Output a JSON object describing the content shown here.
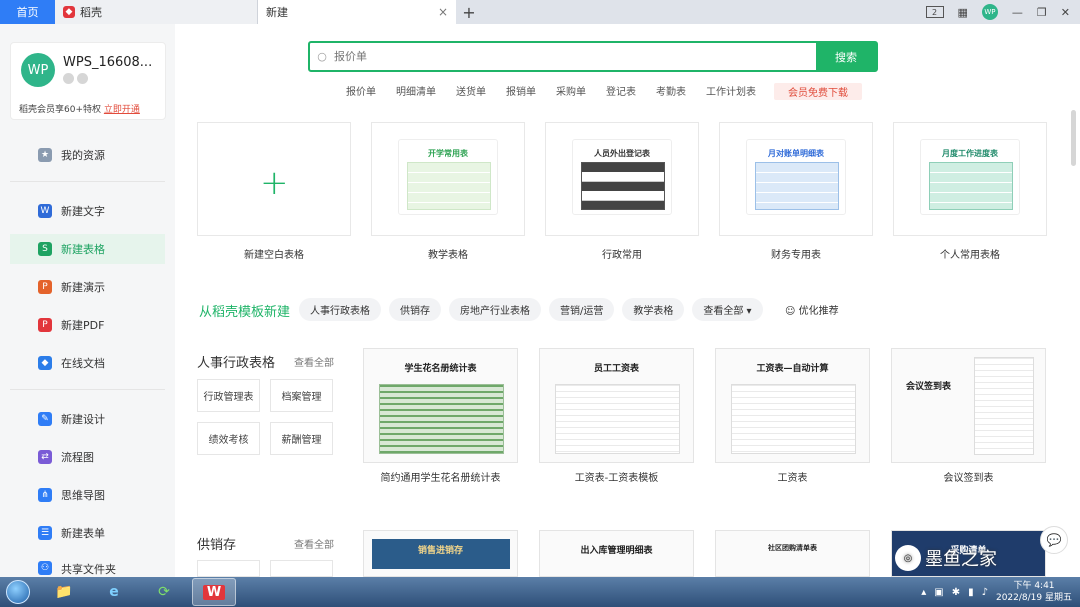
{
  "tabbar": {
    "home": "首页",
    "daoke": "稻壳",
    "new_tab": "新建",
    "close": "×",
    "add": "+"
  },
  "user": {
    "avatar": "WP",
    "name": "WPS_16608...",
    "vip_text": "稻壳会员享60+特权",
    "vip_link": "立即开通"
  },
  "sidebar": {
    "items": [
      {
        "label": "我的资源",
        "icon": "star-icon",
        "color": "#8a9bb0"
      },
      {
        "label": "新建文字",
        "icon": "word-icon",
        "color": "#2f6bd8"
      },
      {
        "label": "新建表格",
        "icon": "sheet-icon",
        "color": "#1ea362"
      },
      {
        "label": "新建演示",
        "icon": "ppt-icon",
        "color": "#e4632b"
      },
      {
        "label": "新建PDF",
        "icon": "pdf-icon",
        "color": "#e2363c"
      },
      {
        "label": "在线文档",
        "icon": "cloud-doc-icon",
        "color": "#2b7de9"
      },
      {
        "label": "新建设计",
        "icon": "design-icon",
        "color": "#2f7df6"
      },
      {
        "label": "流程图",
        "icon": "flowchart-icon",
        "color": "#7a5bd6"
      },
      {
        "label": "思维导图",
        "icon": "mindmap-icon",
        "color": "#2f7df6"
      },
      {
        "label": "新建表单",
        "icon": "form-icon",
        "color": "#2f7df6"
      },
      {
        "label": "共享文件夹",
        "icon": "shared-folder-icon",
        "color": "#2f7df6"
      }
    ]
  },
  "search": {
    "placeholder": "报价单",
    "button": "搜索"
  },
  "hotwords": [
    "报价单",
    "明细清单",
    "送货单",
    "报销单",
    "采购单",
    "登记表",
    "考勤表",
    "工作计划表"
  ],
  "hotwords_vip": "会员免费下载",
  "cards": [
    {
      "label": "新建空白表格",
      "thumb": ""
    },
    {
      "label": "教学表格",
      "thumb": "开学常用表"
    },
    {
      "label": "行政常用",
      "thumb": "人员外出登记表"
    },
    {
      "label": "财务专用表",
      "thumb": "月对账单明细表"
    },
    {
      "label": "个人常用表格",
      "thumb": "月度工作进度表"
    }
  ],
  "templates": {
    "heading": "从稻壳模板新建",
    "chips": [
      "人事行政表格",
      "供销存",
      "房地产行业表格",
      "营销/运营",
      "教学表格",
      "查看全部 ▾"
    ],
    "optimize": "☺ 优化推荐"
  },
  "section_hr": {
    "title": "人事行政表格",
    "more": "查看全部",
    "buttons": [
      "行政管理表",
      "档案管理",
      "绩效考核",
      "薪酬管理"
    ],
    "items": [
      {
        "thumb": "学生花名册统计表",
        "label": "简约通用学生花名册统计表"
      },
      {
        "thumb": "员工工资表",
        "label": "工资表-工资表模板"
      },
      {
        "thumb": "工资表—自动计算",
        "label": "工资表"
      },
      {
        "thumb": "会议签到表",
        "label": "会议签到表"
      }
    ]
  },
  "section_supply": {
    "title": "供销存",
    "more": "查看全部",
    "items": [
      {
        "thumb": "销售进销存"
      },
      {
        "thumb": "出入库管理明细表"
      },
      {
        "thumb": "社区团购清单表"
      },
      {
        "thumb": "采购清单"
      }
    ]
  },
  "taskbar": {
    "time": "下午 4:41",
    "date": "2022/8/19 星期五"
  },
  "watermark": "墨鱼之家"
}
